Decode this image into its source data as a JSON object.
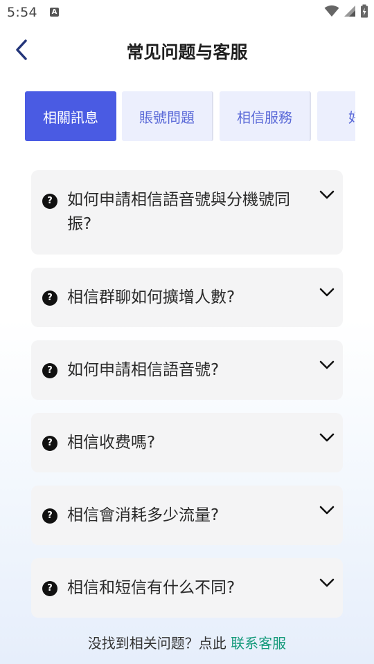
{
  "status_bar": {
    "time": "5:54",
    "notification_badge": "A"
  },
  "header": {
    "title": "常见问题与客服"
  },
  "tabs": [
    {
      "label": "相關訊息",
      "active": true
    },
    {
      "label": "賬號問題",
      "active": false
    },
    {
      "label": "相信服務",
      "active": false
    },
    {
      "label": "好友",
      "active": false
    }
  ],
  "faq": [
    {
      "question": "如何申請相信語音號與分機號同振?"
    },
    {
      "question": "相信群聊如何擴增人數?"
    },
    {
      "question": "如何申請相信語音號?"
    },
    {
      "question": "相信收费嗎?"
    },
    {
      "question": "相信會消耗多少流量?"
    },
    {
      "question": "相信和短信有什么不同?"
    }
  ],
  "footer": {
    "prompt": "没找到相关问题？点此",
    "link": "联系客服"
  },
  "colors": {
    "accent": "#4a5be3",
    "tab_inactive_bg": "#eceffd",
    "tab_inactive_text": "#5b6ad8",
    "link": "#159a7b",
    "card_bg": "#f4f4f5"
  }
}
